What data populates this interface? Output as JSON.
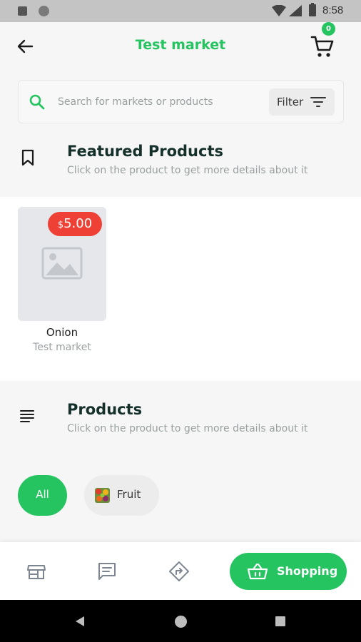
{
  "status_bar": {
    "time": "8:58"
  },
  "app_bar": {
    "title": "Test market",
    "cart_count": "0"
  },
  "search": {
    "placeholder": "Search for markets or products",
    "filter_label": "Filter"
  },
  "featured": {
    "title": "Featured Products",
    "subtitle": "Click on the product to get more details about it",
    "products": [
      {
        "currency": "$",
        "price": "5.00",
        "name": "Onion",
        "market": "Test market"
      }
    ]
  },
  "products": {
    "title": "Products",
    "subtitle": "Click on the product to get more details about it",
    "categories": [
      {
        "label": "All",
        "selected": true
      },
      {
        "label": "Fruit",
        "selected": false
      }
    ]
  },
  "bottom_nav": {
    "items": [
      {
        "icon": "store-icon"
      },
      {
        "icon": "chat-icon"
      },
      {
        "icon": "directions-icon"
      }
    ],
    "shopping_label": "Shopping"
  },
  "colors": {
    "accent": "#25c461",
    "price_badge": "#ef4036"
  }
}
